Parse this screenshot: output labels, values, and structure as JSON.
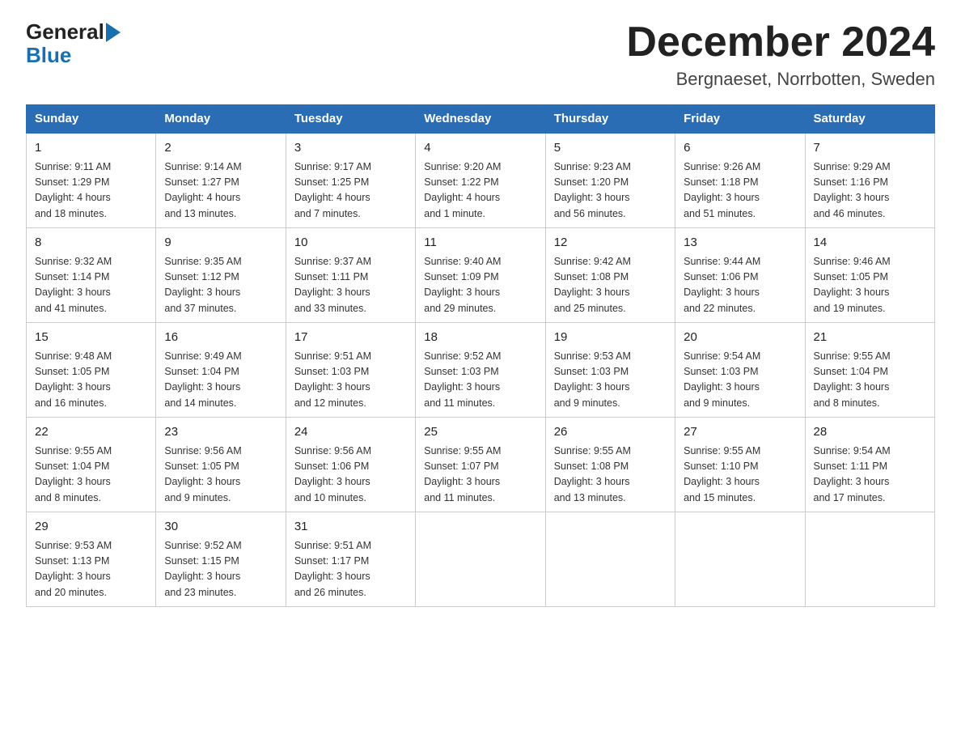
{
  "logo": {
    "general": "General",
    "blue": "Blue"
  },
  "title": "December 2024",
  "location": "Bergnaeset, Norrbotten, Sweden",
  "headers": [
    "Sunday",
    "Monday",
    "Tuesday",
    "Wednesday",
    "Thursday",
    "Friday",
    "Saturday"
  ],
  "weeks": [
    [
      {
        "day": "1",
        "sunrise": "Sunrise: 9:11 AM",
        "sunset": "Sunset: 1:29 PM",
        "daylight": "Daylight: 4 hours",
        "extra": "and 18 minutes."
      },
      {
        "day": "2",
        "sunrise": "Sunrise: 9:14 AM",
        "sunset": "Sunset: 1:27 PM",
        "daylight": "Daylight: 4 hours",
        "extra": "and 13 minutes."
      },
      {
        "day": "3",
        "sunrise": "Sunrise: 9:17 AM",
        "sunset": "Sunset: 1:25 PM",
        "daylight": "Daylight: 4 hours",
        "extra": "and 7 minutes."
      },
      {
        "day": "4",
        "sunrise": "Sunrise: 9:20 AM",
        "sunset": "Sunset: 1:22 PM",
        "daylight": "Daylight: 4 hours",
        "extra": "and 1 minute."
      },
      {
        "day": "5",
        "sunrise": "Sunrise: 9:23 AM",
        "sunset": "Sunset: 1:20 PM",
        "daylight": "Daylight: 3 hours",
        "extra": "and 56 minutes."
      },
      {
        "day": "6",
        "sunrise": "Sunrise: 9:26 AM",
        "sunset": "Sunset: 1:18 PM",
        "daylight": "Daylight: 3 hours",
        "extra": "and 51 minutes."
      },
      {
        "day": "7",
        "sunrise": "Sunrise: 9:29 AM",
        "sunset": "Sunset: 1:16 PM",
        "daylight": "Daylight: 3 hours",
        "extra": "and 46 minutes."
      }
    ],
    [
      {
        "day": "8",
        "sunrise": "Sunrise: 9:32 AM",
        "sunset": "Sunset: 1:14 PM",
        "daylight": "Daylight: 3 hours",
        "extra": "and 41 minutes."
      },
      {
        "day": "9",
        "sunrise": "Sunrise: 9:35 AM",
        "sunset": "Sunset: 1:12 PM",
        "daylight": "Daylight: 3 hours",
        "extra": "and 37 minutes."
      },
      {
        "day": "10",
        "sunrise": "Sunrise: 9:37 AM",
        "sunset": "Sunset: 1:11 PM",
        "daylight": "Daylight: 3 hours",
        "extra": "and 33 minutes."
      },
      {
        "day": "11",
        "sunrise": "Sunrise: 9:40 AM",
        "sunset": "Sunset: 1:09 PM",
        "daylight": "Daylight: 3 hours",
        "extra": "and 29 minutes."
      },
      {
        "day": "12",
        "sunrise": "Sunrise: 9:42 AM",
        "sunset": "Sunset: 1:08 PM",
        "daylight": "Daylight: 3 hours",
        "extra": "and 25 minutes."
      },
      {
        "day": "13",
        "sunrise": "Sunrise: 9:44 AM",
        "sunset": "Sunset: 1:06 PM",
        "daylight": "Daylight: 3 hours",
        "extra": "and 22 minutes."
      },
      {
        "day": "14",
        "sunrise": "Sunrise: 9:46 AM",
        "sunset": "Sunset: 1:05 PM",
        "daylight": "Daylight: 3 hours",
        "extra": "and 19 minutes."
      }
    ],
    [
      {
        "day": "15",
        "sunrise": "Sunrise: 9:48 AM",
        "sunset": "Sunset: 1:05 PM",
        "daylight": "Daylight: 3 hours",
        "extra": "and 16 minutes."
      },
      {
        "day": "16",
        "sunrise": "Sunrise: 9:49 AM",
        "sunset": "Sunset: 1:04 PM",
        "daylight": "Daylight: 3 hours",
        "extra": "and 14 minutes."
      },
      {
        "day": "17",
        "sunrise": "Sunrise: 9:51 AM",
        "sunset": "Sunset: 1:03 PM",
        "daylight": "Daylight: 3 hours",
        "extra": "and 12 minutes."
      },
      {
        "day": "18",
        "sunrise": "Sunrise: 9:52 AM",
        "sunset": "Sunset: 1:03 PM",
        "daylight": "Daylight: 3 hours",
        "extra": "and 11 minutes."
      },
      {
        "day": "19",
        "sunrise": "Sunrise: 9:53 AM",
        "sunset": "Sunset: 1:03 PM",
        "daylight": "Daylight: 3 hours",
        "extra": "and 9 minutes."
      },
      {
        "day": "20",
        "sunrise": "Sunrise: 9:54 AM",
        "sunset": "Sunset: 1:03 PM",
        "daylight": "Daylight: 3 hours",
        "extra": "and 9 minutes."
      },
      {
        "day": "21",
        "sunrise": "Sunrise: 9:55 AM",
        "sunset": "Sunset: 1:04 PM",
        "daylight": "Daylight: 3 hours",
        "extra": "and 8 minutes."
      }
    ],
    [
      {
        "day": "22",
        "sunrise": "Sunrise: 9:55 AM",
        "sunset": "Sunset: 1:04 PM",
        "daylight": "Daylight: 3 hours",
        "extra": "and 8 minutes."
      },
      {
        "day": "23",
        "sunrise": "Sunrise: 9:56 AM",
        "sunset": "Sunset: 1:05 PM",
        "daylight": "Daylight: 3 hours",
        "extra": "and 9 minutes."
      },
      {
        "day": "24",
        "sunrise": "Sunrise: 9:56 AM",
        "sunset": "Sunset: 1:06 PM",
        "daylight": "Daylight: 3 hours",
        "extra": "and 10 minutes."
      },
      {
        "day": "25",
        "sunrise": "Sunrise: 9:55 AM",
        "sunset": "Sunset: 1:07 PM",
        "daylight": "Daylight: 3 hours",
        "extra": "and 11 minutes."
      },
      {
        "day": "26",
        "sunrise": "Sunrise: 9:55 AM",
        "sunset": "Sunset: 1:08 PM",
        "daylight": "Daylight: 3 hours",
        "extra": "and 13 minutes."
      },
      {
        "day": "27",
        "sunrise": "Sunrise: 9:55 AM",
        "sunset": "Sunset: 1:10 PM",
        "daylight": "Daylight: 3 hours",
        "extra": "and 15 minutes."
      },
      {
        "day": "28",
        "sunrise": "Sunrise: 9:54 AM",
        "sunset": "Sunset: 1:11 PM",
        "daylight": "Daylight: 3 hours",
        "extra": "and 17 minutes."
      }
    ],
    [
      {
        "day": "29",
        "sunrise": "Sunrise: 9:53 AM",
        "sunset": "Sunset: 1:13 PM",
        "daylight": "Daylight: 3 hours",
        "extra": "and 20 minutes."
      },
      {
        "day": "30",
        "sunrise": "Sunrise: 9:52 AM",
        "sunset": "Sunset: 1:15 PM",
        "daylight": "Daylight: 3 hours",
        "extra": "and 23 minutes."
      },
      {
        "day": "31",
        "sunrise": "Sunrise: 9:51 AM",
        "sunset": "Sunset: 1:17 PM",
        "daylight": "Daylight: 3 hours",
        "extra": "and 26 minutes."
      },
      null,
      null,
      null,
      null
    ]
  ]
}
